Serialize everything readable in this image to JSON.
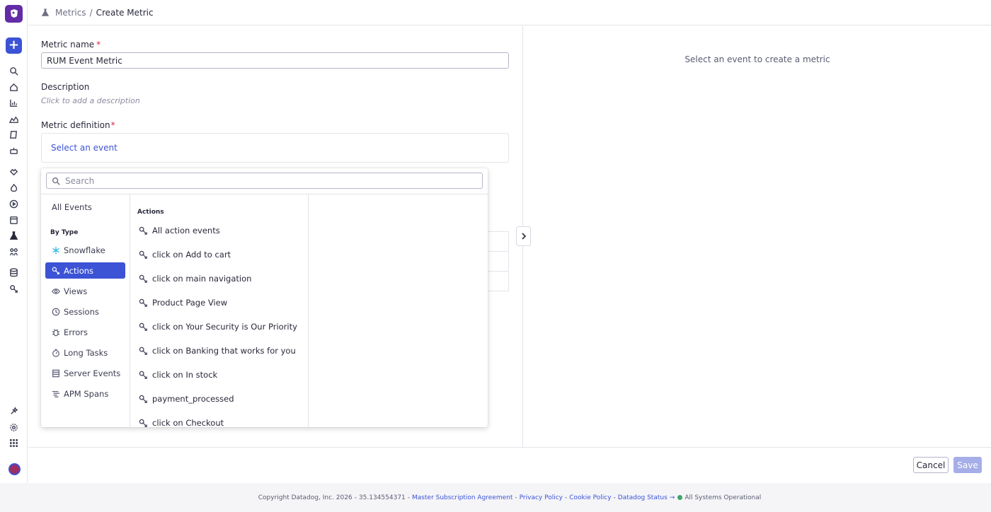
{
  "breadcrumb": {
    "parent": "Metrics",
    "separator": "/",
    "current": "Create Metric"
  },
  "form": {
    "name_label": "Metric name",
    "required_mark": "*",
    "name_value": "RUM Event Metric",
    "description_label": "Description",
    "description_placeholder": "Click to add a description",
    "definition_label": "Metric definition",
    "select_event": "Select an event"
  },
  "right_pane": {
    "placeholder": "Select an event to create a metric"
  },
  "dropdown": {
    "search_placeholder": "Search",
    "all_events": "All Events",
    "by_type_heading": "By Type",
    "types": [
      {
        "label": "Snowflake",
        "icon": "snowflake-icon"
      },
      {
        "label": "Actions",
        "icon": "action-icon",
        "selected": true
      },
      {
        "label": "Views",
        "icon": "eye-icon"
      },
      {
        "label": "Sessions",
        "icon": "clock-icon"
      },
      {
        "label": "Errors",
        "icon": "bug-icon"
      },
      {
        "label": "Long Tasks",
        "icon": "stopwatch-icon"
      },
      {
        "label": "Server Events",
        "icon": "server-icon"
      },
      {
        "label": "APM Spans",
        "icon": "spans-icon"
      }
    ],
    "actions_heading": "Actions",
    "events": [
      "All action events",
      "click on Add to cart",
      "click on main navigation",
      "Product Page View",
      "click on Your Security is Our Priority",
      "click on Banking that works for you",
      "click on In stock",
      "payment_processed",
      "click on Checkout"
    ]
  },
  "buttons": {
    "cancel": "Cancel",
    "save": "Save"
  },
  "footer": {
    "copyright": "Copyright Datadog, Inc. 2026",
    "version": "35.134554371",
    "msa": "Master Subscription Agreement",
    "privacy": "Privacy Policy",
    "cookie": "Cookie Policy",
    "status_link": "Datadog Status",
    "arrow": "→",
    "status_text": "All Systems Operational"
  },
  "colors": {
    "accent": "#3c53d6",
    "brand": "#632ca6",
    "required": "#d02c4b",
    "status_ok": "#3ea66b"
  }
}
